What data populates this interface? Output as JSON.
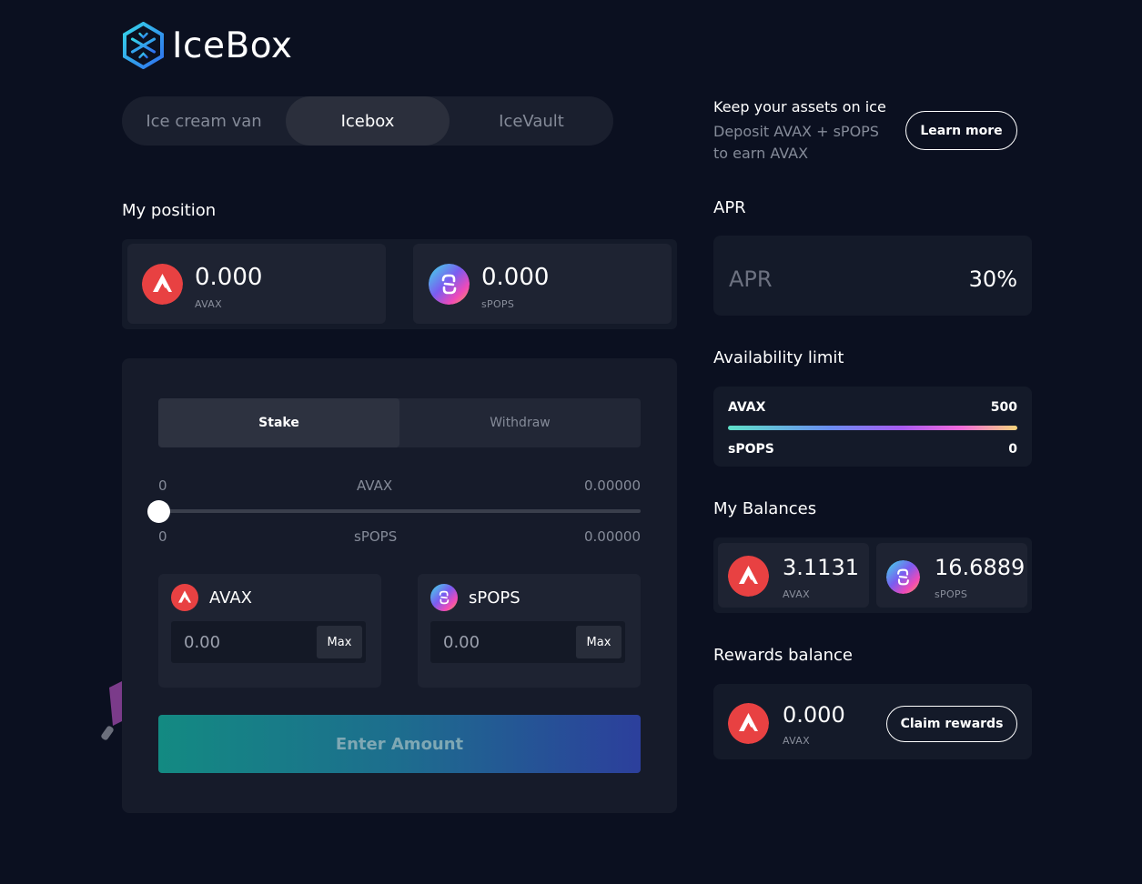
{
  "app": {
    "name": "IceBox"
  },
  "nav": {
    "tabs": [
      "Ice cream van",
      "Icebox",
      "IceVault"
    ],
    "active": 1
  },
  "position": {
    "title": "My position",
    "avax": {
      "value": "0.000",
      "symbol": "AVAX"
    },
    "spops": {
      "value": "0.000",
      "symbol": "sPOPS"
    }
  },
  "stake": {
    "modes": [
      "Stake",
      "Withdraw"
    ],
    "active_mode": 0,
    "slider": {
      "avax": {
        "min": "0",
        "label": "AVAX",
        "max": "0.00000"
      },
      "spops": {
        "min": "0",
        "label": "sPOPS",
        "max": "0.00000"
      },
      "fraction": 0
    },
    "inputs": [
      {
        "token": "AVAX",
        "placeholder": "0.00",
        "max_label": "Max"
      },
      {
        "token": "sPOPS",
        "placeholder": "0.00",
        "max_label": "Max"
      }
    ],
    "submit_label": "Enter Amount"
  },
  "info": {
    "title": "Keep your assets on ice",
    "subtitle": "Deposit AVAX + sPOPS to earn AVAX",
    "learn_more": "Learn more"
  },
  "apr": {
    "title": "APR",
    "label": "APR",
    "value": "30%"
  },
  "availability": {
    "title": "Availability limit",
    "rows": [
      {
        "token": "AVAX",
        "value": "500"
      },
      {
        "token": "sPOPS",
        "value": "0"
      }
    ]
  },
  "balances": {
    "title": "My Balances",
    "avax": {
      "value": "3.1131",
      "symbol": "AVAX"
    },
    "spops": {
      "value": "16.6889",
      "symbol": "sPOPS"
    }
  },
  "rewards": {
    "title": "Rewards balance",
    "value": "0.000",
    "symbol": "AVAX",
    "claim_label": "Claim rewards"
  },
  "colors": {
    "background": "#0b1020",
    "card": "#141a29",
    "avax_red": "#e84142",
    "accent_teal": "#138a82",
    "accent_blue": "#2c3f9c"
  }
}
